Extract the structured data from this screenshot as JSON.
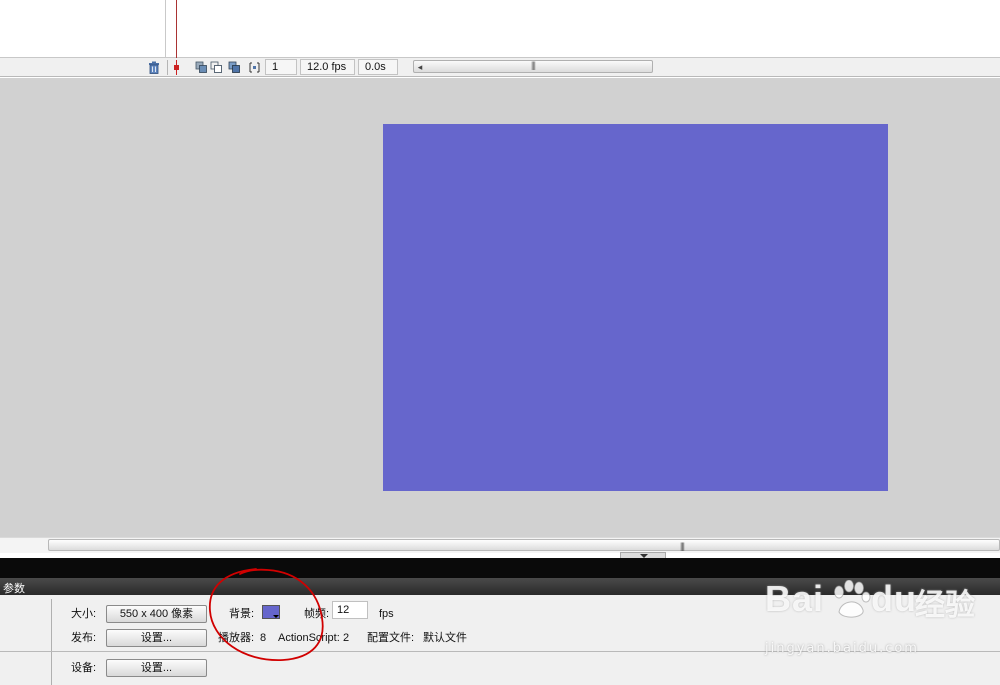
{
  "colors": {
    "stage_background": "#6666cc",
    "work_area": "#d1d1d1",
    "annotation_circle": "#d10000"
  },
  "timeline_toolbar": {
    "icons": [
      "trash-icon",
      "playhead-marker-icon",
      "onion-skin-icon",
      "onion-skin-outlines-icon",
      "edit-multiple-frames-icon",
      "modify-onion-markers-icon"
    ],
    "current_frame": "1",
    "frame_rate": "12.0 fps",
    "elapsed_time": "0.0s"
  },
  "panel": {
    "tab_label": "参数"
  },
  "properties": {
    "size_label": "大小:",
    "size_button": "550 x 400 像素",
    "background_label": "背景:",
    "frame_rate_label": "帧频:",
    "frame_rate_value": "12",
    "fps_unit": "fps",
    "publish_label": "发布:",
    "publish_button": "设置...",
    "player_label": "播放器:",
    "player_value": "8",
    "actionscript_label": "ActionScript:",
    "actionscript_value": "2",
    "profile_label": "配置文件:",
    "profile_value": "默认文件",
    "device_label": "设备:",
    "device_button": "设置..."
  },
  "watermark": {
    "brand_text": "Bai",
    "brand_text_2": "du",
    "brand_cn": "经验",
    "url": "jingyan.baidu.com"
  }
}
